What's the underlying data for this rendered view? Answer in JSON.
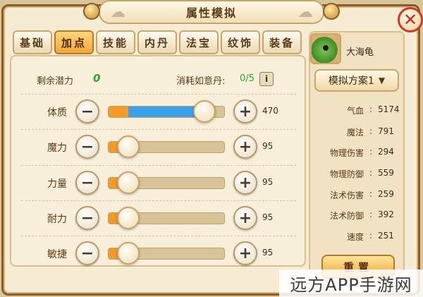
{
  "window": {
    "title": "属性模拟"
  },
  "close_label": "✕",
  "tabs": [
    {
      "label": "基础",
      "active": false
    },
    {
      "label": "加点",
      "active": true
    },
    {
      "label": "技能",
      "active": false
    },
    {
      "label": "内丹",
      "active": false
    },
    {
      "label": "法宝",
      "active": false
    },
    {
      "label": "纹饰",
      "active": false
    },
    {
      "label": "装备",
      "active": false
    }
  ],
  "potential": {
    "label": "剩余潜力",
    "value": "0"
  },
  "consume": {
    "label": "消耗如意丹:",
    "value": "0/5",
    "info_label": "i"
  },
  "attributes": [
    {
      "label": "体质",
      "value": "470",
      "level": 0.82,
      "base_level": 0.17
    },
    {
      "label": "魔力",
      "value": "95",
      "level": 0.17,
      "base_level": 0.17
    },
    {
      "label": "力量",
      "value": "95",
      "level": 0.17,
      "base_level": 0.17
    },
    {
      "label": "耐力",
      "value": "95",
      "level": 0.17,
      "base_level": 0.17
    },
    {
      "label": "敏捷",
      "value": "95",
      "level": 0.17,
      "base_level": 0.17
    }
  ],
  "buttons": {
    "minus": "−",
    "plus": "+"
  },
  "character": {
    "name": "大海龟",
    "avatar_icon": "turtle-avatar"
  },
  "scheme": {
    "label": "模拟方案1"
  },
  "stats": [
    {
      "name": "气血",
      "value": "5174"
    },
    {
      "name": "魔法",
      "value": "791"
    },
    {
      "name": "物理伤害",
      "value": "294"
    },
    {
      "name": "物理防御",
      "value": "559"
    },
    {
      "name": "法术伤害",
      "value": "259"
    },
    {
      "name": "法术防御",
      "value": "392"
    },
    {
      "name": "速度",
      "value": "251"
    }
  ],
  "reset_label": "重置",
  "watermark": "远方APP手游网",
  "colors": {
    "accent_orange": "#f29a2a",
    "accent_blue": "#3ea0e8",
    "potential_green": "#2aa82a"
  }
}
